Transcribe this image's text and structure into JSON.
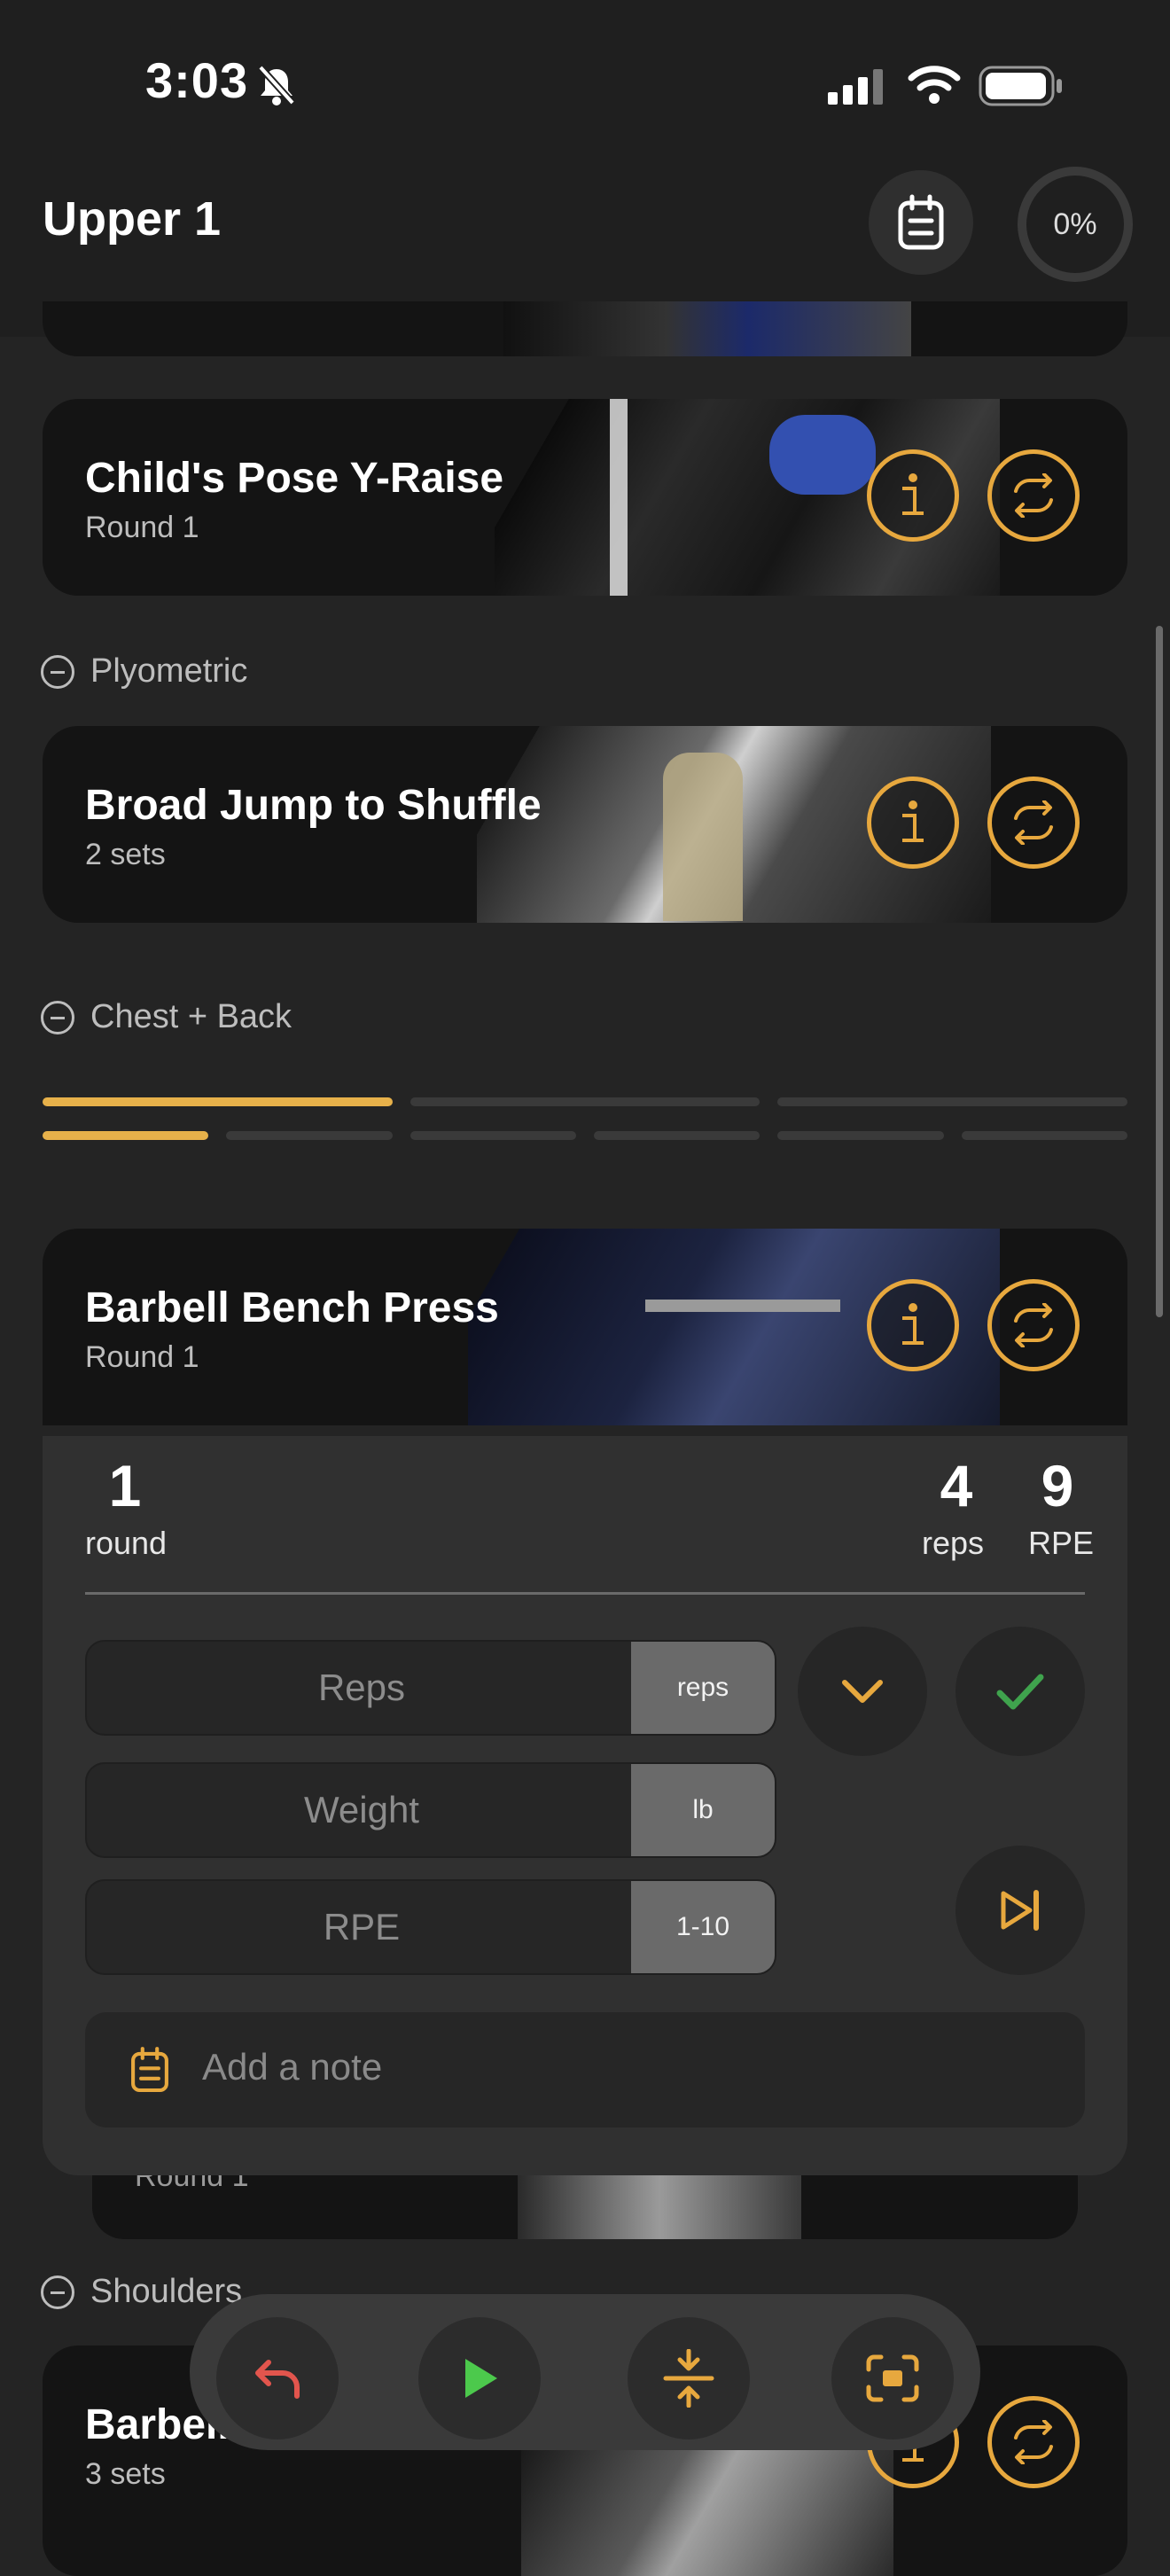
{
  "status_bar": {
    "time": "3:03"
  },
  "header": {
    "title": "Upper 1",
    "progress": "0%"
  },
  "cards": [
    {
      "title": "Child's Pose Y-Raise",
      "subtitle": "Round 1"
    },
    {
      "title": "Broad Jump to Shuffle",
      "subtitle": "2 sets"
    },
    {
      "title": "Barbell Bench Press",
      "subtitle": "Round 1"
    },
    {
      "title": "Barbell",
      "subtitle": "3 sets"
    }
  ],
  "hidden_card": {
    "subtitle": "Round 1"
  },
  "sections": [
    "Plyometric",
    "Chest + Back",
    "Shoulders"
  ],
  "progress_segments": {
    "row1_filled": 1,
    "row1_total": 3,
    "row2_filled": 1,
    "row2_total": 6
  },
  "set_panel": {
    "round_value": "1",
    "round_label": "round",
    "reps_value": "4",
    "reps_label": "reps",
    "rpe_value": "9",
    "rpe_label": "RPE",
    "fields": [
      {
        "label": "Reps",
        "unit": "reps"
      },
      {
        "label": "Weight",
        "unit": "lb"
      },
      {
        "label": "RPE",
        "unit": "1-10"
      }
    ],
    "note_placeholder": "Add a note"
  },
  "icons": {
    "info": "info-icon",
    "swap": "swap-icon",
    "notes": "notes-icon",
    "check": "check-icon",
    "chevron": "chevron-down-icon",
    "skip": "skip-next-icon",
    "undo": "undo-icon",
    "play": "play-icon",
    "compress": "compress-icon",
    "focus": "focus-icon"
  },
  "colors": {
    "accent": "#e7b14a",
    "check": "#3fa34d",
    "play": "#4cc94c",
    "undo": "#e2554d"
  }
}
